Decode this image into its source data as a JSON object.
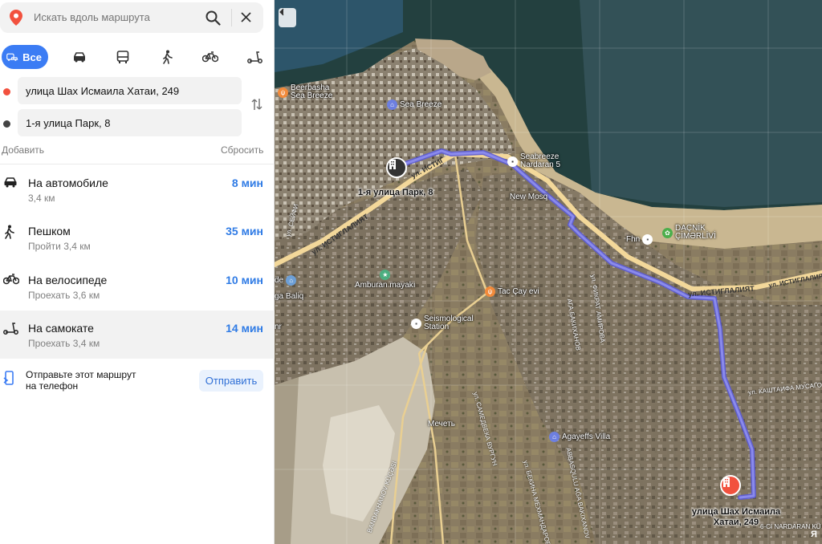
{
  "search": {
    "placeholder": "Искать вдоль маршрута"
  },
  "modes": [
    {
      "name": "all",
      "label": "Все",
      "icon": "all-transport-icon",
      "active": true
    },
    {
      "name": "car",
      "icon": "car-icon"
    },
    {
      "name": "bus",
      "icon": "bus-icon"
    },
    {
      "name": "walk",
      "icon": "pedestrian-icon"
    },
    {
      "name": "bike",
      "icon": "bicycle-icon"
    },
    {
      "name": "scooter",
      "icon": "scooter-icon"
    }
  ],
  "route": {
    "from": "улица Шах Исмаила Хатаи, 249",
    "to": "1-я улица Парк, 8",
    "add_label": "Добавить",
    "reset_label": "Сбросить"
  },
  "options": [
    {
      "title": "На автомобиле",
      "sub": "3,4 км",
      "time": "8 мин",
      "icon": "car-icon"
    },
    {
      "title": "Пешком",
      "sub": "Пройти 3,4 км",
      "time": "35 мин",
      "icon": "pedestrian-icon"
    },
    {
      "title": "На велосипеде",
      "sub": "Проехать 3,6 км",
      "time": "10 мин",
      "icon": "bicycle-icon"
    },
    {
      "title": "На самокате",
      "sub": "Проехать 3,4 км",
      "time": "14 мин",
      "icon": "scooter-icon",
      "selected": true
    }
  ],
  "send": {
    "text_line1": "Отправьте этот маршрут",
    "text_line2": "на телефон",
    "button": "Отправить"
  },
  "map": {
    "start_label": "1-я улица Парк, 8",
    "dest_label_line1": "улица Шах Исмаила",
    "dest_label_line2": "Хатаи, 249",
    "labels": {
      "beerbasha": "Beerbasha",
      "seabreeze_small": "Sea Breeze",
      "sea_breeze": "Sea Breeze",
      "seabreeze_nardaran": "Seabreeze",
      "nardaran5": "Nardaran 5",
      "new_mosque": "New Mosq",
      "dacnik": "DAÇNİK",
      "cimerlivi": "ÇİMƏRLİVİ",
      "fhn": "Fhn",
      "amburan": "Amburan mayakı",
      "tac_cay": "Tac Çay evi",
      "seismo1": "Seismological",
      "seismo2": "Station",
      "mechet": "Мечеть",
      "agayeffs": "Agayeffs Villa",
      "ga_baliq": "ga Baliq",
      "de": "de",
      "nr": "nr"
    },
    "roads": {
      "istiglaliyat_1": "ул. ИСТИГЛАЛИЯТ",
      "istiglaliyat_2": "ул. ИСТИГ",
      "istiglaliyat_3": "ул. ИСТИГЛАЛИЯТ",
      "istiglaliyat_4": "ул. ИСТИГЛАЛИЯТ",
      "kashtaifa": "ул. КАШТАИФА МУСАГО",
      "bandakhanov": "BANDAKHANOV KÜÇƏSİ",
      "nardaran": "6-CI NARDARAN KÜ",
      "seyfi": "ул. СЕЙФИ",
      "aga_bakhanov": "АГА БАКИХАНОВ",
      "fikrat": "ул. ФИКРАТ АМИРОВА",
      "samed": "ул. САМЕДВЕКА ВУРГУН",
      "mekhmandarova": "ул. БЕКИНА МЕХМАНДАРОВА",
      "abbasqulu": "ABBASQULU AĞA BAKIXANOV"
    },
    "logo": "Я"
  }
}
